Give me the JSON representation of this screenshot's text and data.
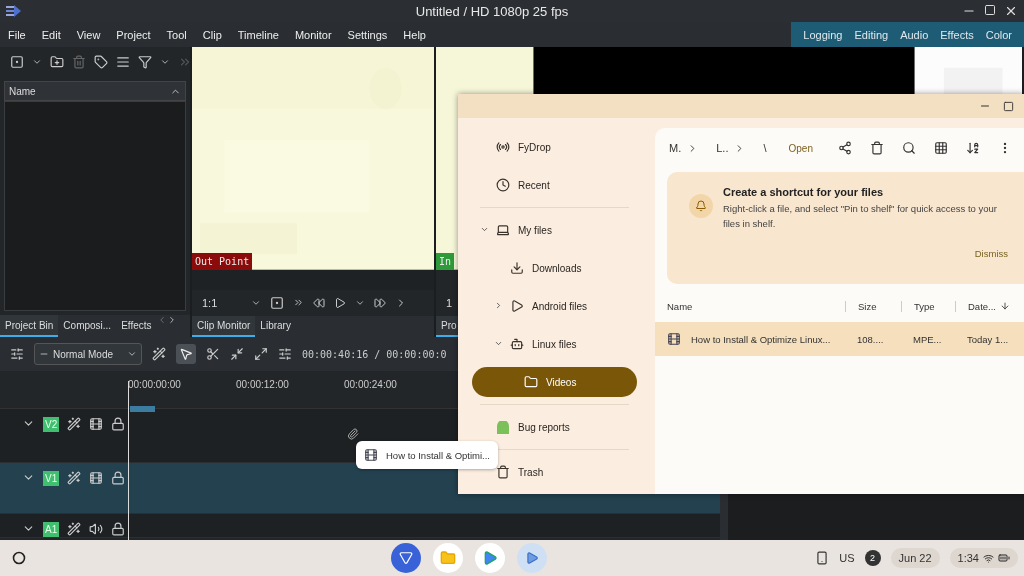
{
  "window": {
    "title": "Untitled / HD 1080p 25 fps"
  },
  "menu": [
    "File",
    "Edit",
    "View",
    "Project",
    "Tool",
    "Clip",
    "Timeline",
    "Monitor",
    "Settings",
    "Help"
  ],
  "workspaces": [
    "Logging",
    "Editing",
    "Audio",
    "Effects",
    "Color"
  ],
  "project_bin": {
    "column": "Name",
    "tabs": [
      {
        "label": "Project Bin",
        "selected": true
      },
      {
        "label": "Composi...",
        "selected": false
      },
      {
        "label": "Effects",
        "selected": false
      }
    ]
  },
  "clip_monitor": {
    "marker": "Out Point",
    "zoom": "1:1",
    "tabs": [
      {
        "label": "Clip Monitor",
        "selected": true
      },
      {
        "label": "Library",
        "selected": false
      }
    ]
  },
  "project_monitor": {
    "marker": "In",
    "zoom": "1",
    "tabs": [
      {
        "label": "Pro",
        "selected": true
      }
    ]
  },
  "timeline": {
    "mode": "Normal Mode",
    "timecode": "00:00:40:16 / 00:00:00:0",
    "ruler": [
      "00:00:00:00",
      "00:00:12:00",
      "00:00:24:00"
    ],
    "tracks": [
      {
        "name": "V2",
        "kind": "video",
        "selected": false
      },
      {
        "name": "V1",
        "kind": "video",
        "selected": true
      },
      {
        "name": "A1",
        "kind": "audio",
        "selected": false
      }
    ]
  },
  "files": {
    "breadcrumbs": [
      "M.",
      "L..",
      "\\"
    ],
    "open": "Open",
    "sidebar": [
      {
        "label": "FyDrop",
        "kind": "nearby",
        "selected": false
      },
      {
        "label": "Recent",
        "kind": "recent",
        "selected": false
      },
      {
        "label": "My files",
        "kind": "laptop",
        "selected": false,
        "expanded": true,
        "children": [
          {
            "label": "Downloads",
            "kind": "download",
            "selected": false
          },
          {
            "label": "Android files",
            "kind": "play",
            "selected": false,
            "expanded": false
          },
          {
            "label": "Linux files",
            "kind": "linux",
            "selected": false,
            "expanded": true,
            "children": [
              {
                "label": "Videos",
                "kind": "folder",
                "selected": true
              }
            ]
          }
        ]
      },
      {
        "label": "Bug reports",
        "kind": "android",
        "selected": false
      },
      {
        "label": "Trash",
        "kind": "trash",
        "selected": false
      }
    ],
    "banner": {
      "title": "Create a shortcut for your files",
      "body": "Right-click a file, and select \"Pin to shelf\" for quick access to your files in shelf.",
      "dismiss": "Dismiss"
    },
    "columns": [
      "Name",
      "Size",
      "Type",
      "Date..."
    ],
    "rows": [
      {
        "name": "How to Install & Optimize Linux...",
        "size": "108....",
        "type": "MPE...",
        "date": "Today 1...",
        "selected": true
      }
    ]
  },
  "drag_chip": {
    "label": "How to Install & Optimi..."
  },
  "shelf": {
    "keyboard": "US",
    "notifications": "2",
    "date": "Jun 22",
    "time": "1:34"
  }
}
